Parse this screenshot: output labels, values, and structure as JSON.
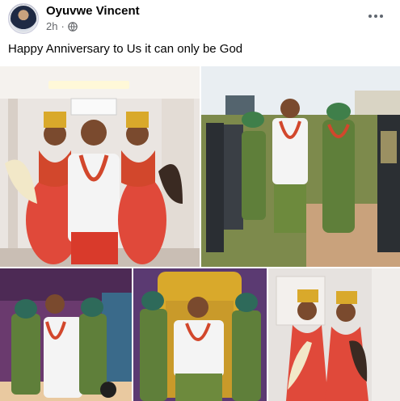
{
  "post": {
    "author": "Oyuvwe Vincent",
    "timestamp": "2h",
    "separator": "·",
    "privacy_icon": "globe-icon",
    "caption": "Happy Anniversary to Us it can only be God",
    "more_icon": "more-options-icon"
  },
  "photos": [
    {
      "id": "photo-1",
      "subject": "couple-indoor-portrait"
    },
    {
      "id": "photo-2",
      "subject": "outdoor-procession"
    },
    {
      "id": "photo-3",
      "subject": "group-seated-portrait"
    },
    {
      "id": "photo-4",
      "subject": "group-throne-portrait"
    },
    {
      "id": "photo-5",
      "subject": "two-women-portrait"
    }
  ],
  "colors": {
    "coral": "#e0493a",
    "beads": "#d2472c",
    "green_attire": "#5f7f3a",
    "gold": "#d9a92b",
    "white": "#f4f4f4"
  }
}
